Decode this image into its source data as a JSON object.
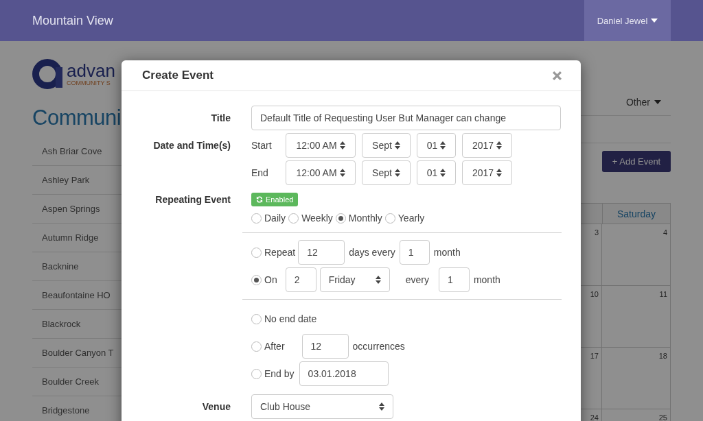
{
  "header": {
    "title": "Mountain View",
    "user": "Daniel Jewel"
  },
  "logo": {
    "name": "advan",
    "tagline": "COMMUNITY S"
  },
  "sidebar": {
    "heading": "Communi",
    "items": [
      "Ash Briar Cove",
      "Ashley Park",
      "Aspen Springs",
      "Autumn Ridge",
      "Backnine",
      "Beaufontaine HO",
      "Blackrock",
      "Boulder Canyon T",
      "Boulder Creek",
      "Bridgestone"
    ]
  },
  "toolbar": {
    "filter": "Other",
    "add_button": "+ Add Event"
  },
  "calendar": {
    "heading": "Saturday",
    "rows": [
      [
        "3",
        "4"
      ],
      [
        "10",
        "11"
      ],
      [
        "17",
        "18"
      ],
      [
        "24",
        "25"
      ]
    ]
  },
  "modal": {
    "title": "Create Event",
    "title_label": "Title",
    "title_value": "Default Title of Requesting User But Manager can change",
    "date_label": "Date and Time(s)",
    "dates": [
      {
        "label": "Start",
        "time": "12:00 AM",
        "month": "Sept",
        "day": "01",
        "year": "2017"
      },
      {
        "label": "End",
        "time": "12:00 AM",
        "month": "Sept",
        "day": "01",
        "year": "2017"
      }
    ],
    "repeat_label": "Repeating Event",
    "repeat_badge": {
      "label": "Enabled",
      "enabled": true
    },
    "frequencies": [
      {
        "label": "Daily",
        "selected": false
      },
      {
        "label": "Weekly",
        "selected": false
      },
      {
        "label": "Monthly",
        "selected": true
      },
      {
        "label": "Yearly",
        "selected": false
      }
    ],
    "repeat_by": [
      {
        "kind": "days",
        "selected": false,
        "label": "Repeat",
        "count": "12",
        "middle": "days every",
        "interval": "1",
        "unit": "month"
      },
      {
        "kind": "weekday",
        "selected": true,
        "label": "On",
        "count": "2",
        "weekday": "Friday",
        "middle": "every",
        "interval": "1",
        "unit": "month"
      }
    ],
    "end": [
      {
        "kind": "none",
        "selected": false,
        "label": "No end date"
      },
      {
        "kind": "after",
        "selected": false,
        "label": "After",
        "value": "12",
        "suffix": "occurrences"
      },
      {
        "kind": "date",
        "selected": false,
        "label": "End by",
        "value": "03.01.2018"
      }
    ],
    "venue_label": "Venue",
    "venue": "Club House"
  }
}
